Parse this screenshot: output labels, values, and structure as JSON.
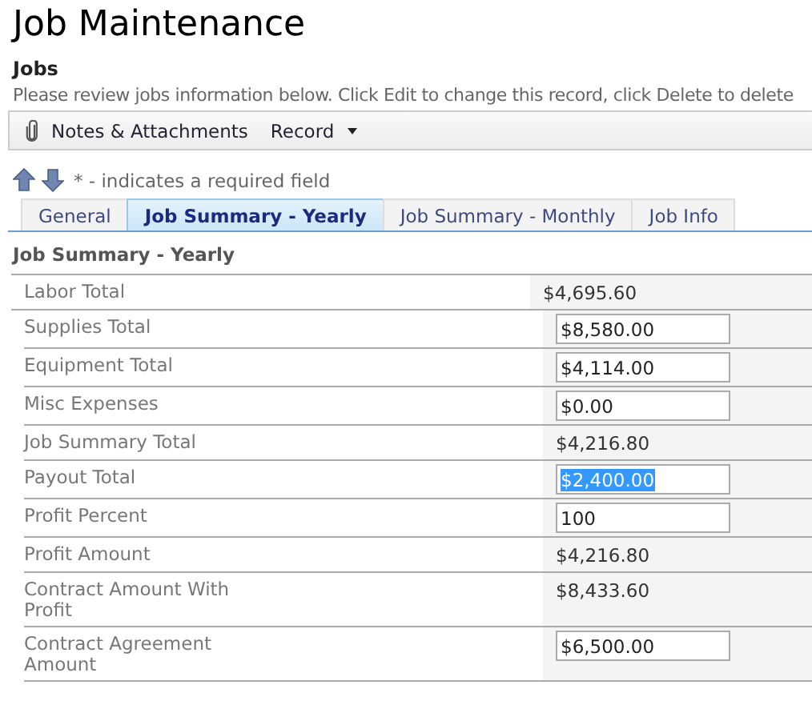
{
  "page_title": "Job Maintenance",
  "section_title": "Jobs",
  "description": "Please review jobs information below. Click Edit to change this record, click Delete to delete",
  "toolbar": [
    {
      "kind": "attachment",
      "label": "Notes & Attachments"
    },
    {
      "kind": "dropdown",
      "label": "Record"
    }
  ],
  "required_note": "* - indicates a required field",
  "tabs": [
    {
      "label": "General",
      "selected": false
    },
    {
      "label": "Job Summary - Yearly",
      "selected": true
    },
    {
      "label": "Job Summary - Monthly",
      "selected": false
    },
    {
      "label": "Job Info",
      "selected": false
    }
  ],
  "panel_title": "Job Summary - Yearly",
  "rows": [
    {
      "label": "Labor Total",
      "kind": "text",
      "value": "$4,695.60"
    },
    {
      "label": "Supplies Total",
      "kind": "input",
      "value": "$8,580.00",
      "highlighted": false
    },
    {
      "label": "Equipment Total",
      "kind": "input",
      "value": "$4,114.00",
      "highlighted": false
    },
    {
      "label": "Misc Expenses",
      "kind": "input",
      "value": "$0.00",
      "highlighted": false
    },
    {
      "label": "Job Summary Total",
      "kind": "text",
      "value": "$4,216.80"
    },
    {
      "label": "Payout Total",
      "kind": "input",
      "value": "$2,400.00",
      "highlighted": true
    },
    {
      "label": "Profit Percent",
      "kind": "input",
      "value": "100",
      "highlighted": false
    },
    {
      "label": "Profit Amount",
      "kind": "text",
      "value": "$4,216.80"
    },
    {
      "label": "Contract Amount With Profit",
      "kind": "text",
      "value": "$8,433.60"
    },
    {
      "label": "Contract Agreement Amount",
      "kind": "input",
      "value": "$6,500.00",
      "highlighted": false
    }
  ]
}
